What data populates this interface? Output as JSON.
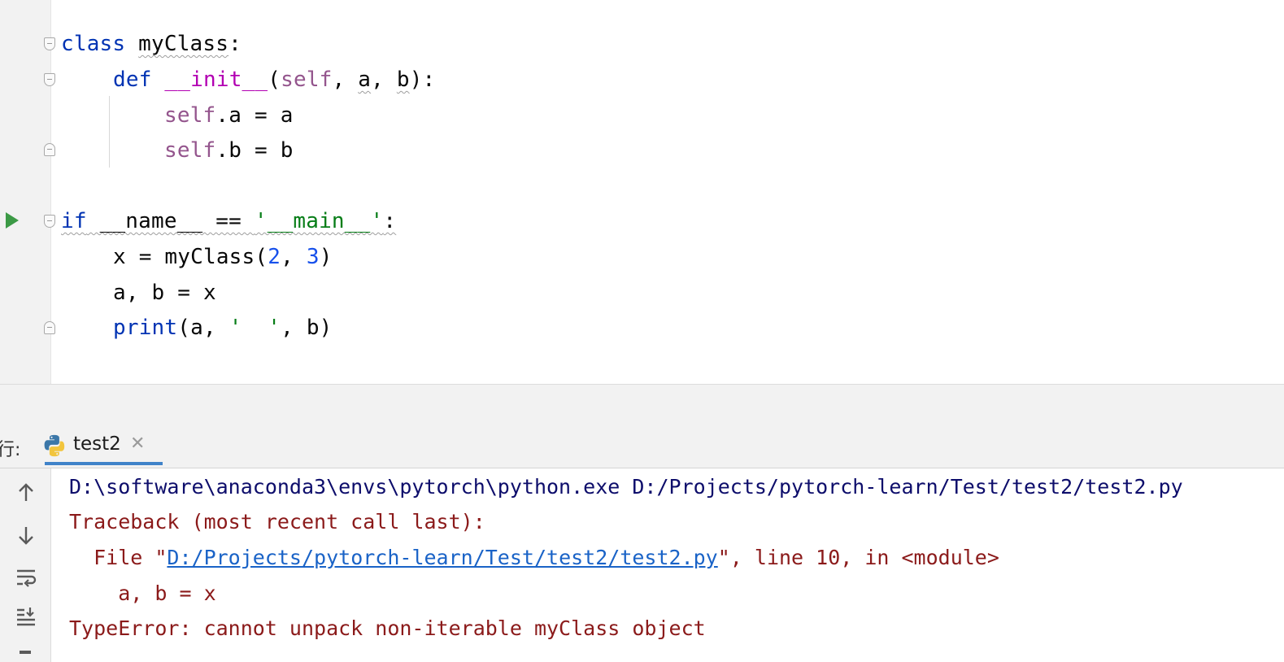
{
  "editor": {
    "lines": {
      "l1": {
        "kw": "class",
        "name": "myClass",
        "colon": ":"
      },
      "l2": {
        "kw": "def",
        "fn": "__init__",
        "open": "(",
        "self": "self",
        "sep1": ", ",
        "a": "a",
        "sep2": ", ",
        "b": "b",
        "close": "):"
      },
      "l3": {
        "self": "self",
        "rest": ".a = a"
      },
      "l4": {
        "self": "self",
        "rest": ".b = b"
      },
      "l5": {
        "kw": "if",
        "mid": " __name__ == ",
        "str": "'__main__'",
        "colon": ":"
      },
      "l6": {
        "pre": "x = myClass(",
        "n1": "2",
        "sep": ", ",
        "n2": "3",
        "close": ")"
      },
      "l7": {
        "text": "a, b = x"
      },
      "l8": {
        "fn": "print",
        "pre": "(a, ",
        "str": "'  '",
        "post": ", b)"
      }
    }
  },
  "run_panel": {
    "label": "行:",
    "tab_title": "test2",
    "tab_close": "✕",
    "icons": [
      "arrow-up-icon",
      "arrow-down-icon",
      "soft-wrap-icon",
      "scroll-to-end-icon"
    ]
  },
  "console": {
    "cmd": "D:\\software\\anaconda3\\envs\\pytorch\\python.exe D:/Projects/pytorch-learn/Test/test2/test2.py",
    "traceback": "Traceback (most recent call last):",
    "file_pre": "  File \"",
    "file_link": "D:/Projects/pytorch-learn/Test/test2/test2.py",
    "file_post": "\", line 10, in <module>",
    "code": "    a, b = x",
    "error": "TypeError: cannot unpack non-iterable myClass object"
  },
  "colors": {
    "keyword": "#0033b3",
    "dunder": "#b200b2",
    "self": "#94558d",
    "string": "#067d17",
    "number": "#1750eb",
    "error_text": "#8b1a1a",
    "link": "#1a63c7",
    "run_green": "#3c9a46"
  }
}
